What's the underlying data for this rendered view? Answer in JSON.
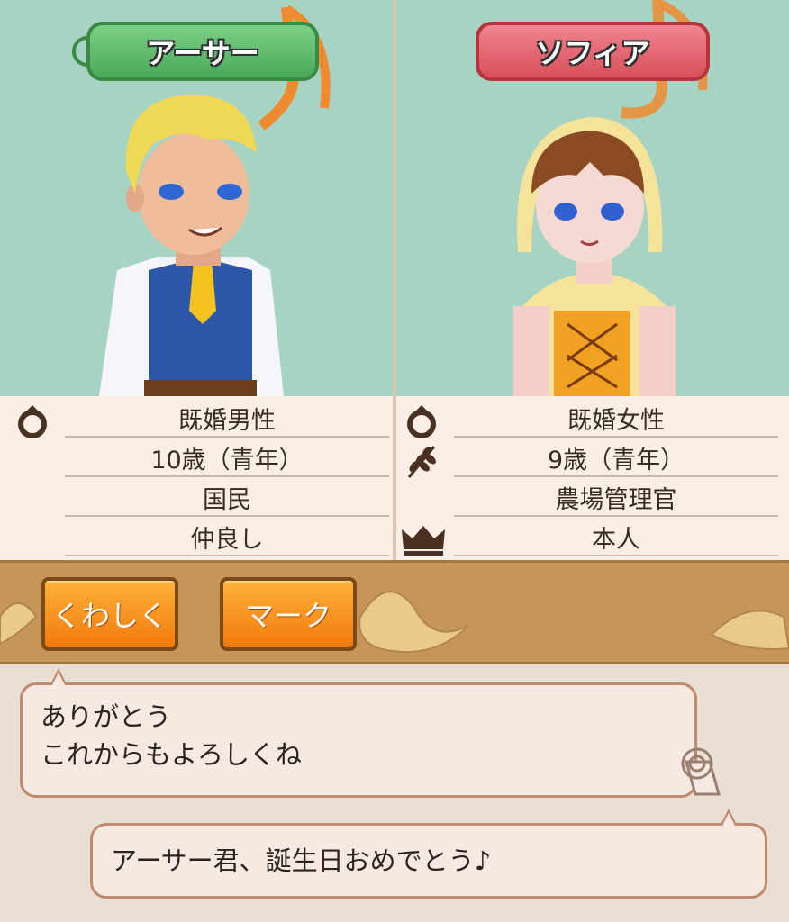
{
  "characters": {
    "left": {
      "name": "アーサー",
      "tag_color": "#4aa95a",
      "info": [
        "既婚男性",
        "10歳（青年）",
        "国民",
        "仲良し"
      ],
      "icons": [
        "ring-icon"
      ]
    },
    "right": {
      "name": "ソフィア",
      "tag_color": "#d8505c",
      "info": [
        "既婚女性",
        "9歳（青年）",
        "農場管理官",
        "本人"
      ],
      "icons": [
        "ring-icon",
        "wheat-icon",
        "crown-icon"
      ]
    }
  },
  "buttons": {
    "detail_label": "くわしく",
    "mark_label": "マーク"
  },
  "dialogue": {
    "arthur_line1": "ありがとう",
    "arthur_line2": "これからもよろしくね",
    "sofia_line": "アーサー君、誕生日おめでとう♪"
  },
  "colors": {
    "accent_orange": "#f17a0c",
    "panel_bg": "#a6d3c2",
    "bar_brown": "#c6955a"
  }
}
